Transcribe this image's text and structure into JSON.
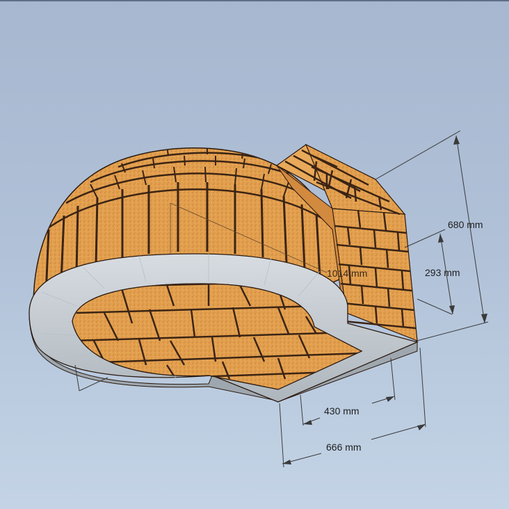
{
  "colors": {
    "background_top": "#a7b7cf",
    "background_bottom": "#c4d4e6",
    "brick": "#e5a24e",
    "brick_dark": "#c9782d",
    "mortar": "#3b2414",
    "concrete": "#c7cdd3",
    "concrete_dark": "#9aa3ab"
  },
  "dimensions": {
    "height_total": "680 mm",
    "height_opening": "293 mm",
    "width_inner": "430 mm",
    "width_outer": "666 mm",
    "diameter_partial": "1014 mm"
  }
}
